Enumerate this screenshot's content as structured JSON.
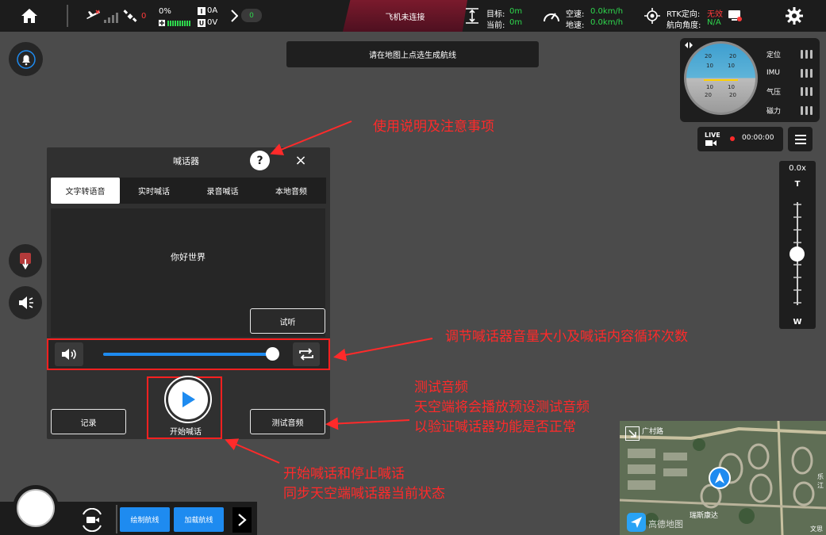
{
  "topbar": {
    "gps_count": "0",
    "battery_pct": "0%",
    "battery_current": "0A",
    "battery_voltage": "0V",
    "signal_count": "0",
    "status": "飞机未连接",
    "target_label": "目标:",
    "target_value": "0m",
    "current_label": "当前:",
    "current_value": "0m",
    "airspeed_label": "空速:",
    "airspeed_value": "0.0km/h",
    "groundspeed_label": "地速:",
    "groundspeed_value": "0.0km/h",
    "rtk_label": "RTK定向:",
    "rtk_value": "无效",
    "heading_label": "航向角度:",
    "heading_value": "N/A"
  },
  "map_hint": "请在地图上点选生成航线",
  "annotations": {
    "help": "使用说明及注意事项",
    "volume": "调节喊话器音量大小及喊话内容循环次数",
    "test_audio": [
      "测试音频",
      "天空端将会播放预设测试音频",
      "以验证喊话器功能是否正常"
    ],
    "start_stop": [
      "开始喊话和停止喊话",
      "同步天空端喊话器当前状态"
    ]
  },
  "panel": {
    "title": "喊话器",
    "help_symbol": "?",
    "close_symbol": "×",
    "tabs": [
      "文字转语音",
      "实时喊话",
      "录音喊话",
      "本地音频"
    ],
    "active_tab": 0,
    "text_content": "你好世界",
    "preview_label": "试听",
    "volume_level": 0.97,
    "record_label": "记录",
    "start_label": "开始喊话",
    "test_audio_label": "测试音频"
  },
  "attitude": {
    "scale_top": [
      "20",
      "20"
    ],
    "scale_mid_upper": [
      "10",
      "10"
    ],
    "scale_mid_lower": [
      "10",
      "10"
    ],
    "scale_bottom": [
      "20",
      "20"
    ],
    "status_items": [
      "定位",
      "IMU",
      "气压",
      "磁力"
    ]
  },
  "live": {
    "label": "LIVE",
    "time": "00:00:00"
  },
  "zoom": {
    "level": "0.0x",
    "tele": "T",
    "wide": "W",
    "slider_position": 0.5
  },
  "bottom": {
    "draw_route": "绘制航线",
    "load_route": "加载航线"
  },
  "map": {
    "road_label": "广村路",
    "place_label": "瑞斯康达",
    "edge_label_1": "乐江",
    "edge_label_2": "文思",
    "logo_text": "高德地图"
  },
  "colors": {
    "accent_blue": "#1e8bf0",
    "annotation_red": "#ff2a2a",
    "status_green": "#2fd84e"
  }
}
